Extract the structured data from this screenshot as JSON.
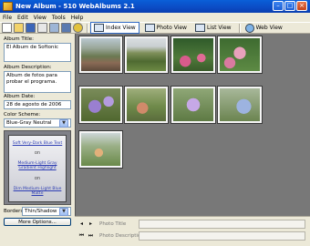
{
  "window": {
    "title": "New Album - 510 WebAlbums 2.1"
  },
  "menu": {
    "items": [
      "File",
      "Edit",
      "View",
      "Tools",
      "Help"
    ]
  },
  "toolbar": {
    "views": [
      {
        "label": "Index View",
        "active": true
      },
      {
        "label": "Photo View",
        "active": false
      },
      {
        "label": "List View",
        "active": false
      },
      {
        "label": "Web View",
        "active": false
      }
    ]
  },
  "left": {
    "album_title_label": "Album Title:",
    "album_title_value": "El Album de Softonic",
    "album_description_label": "Album Description:",
    "album_description_value": "Album de fotos para probar el programa.",
    "album_date_label": "Album Date:",
    "album_date_value": "28 de agosto de 2006",
    "color_scheme_label": "Color Scheme:",
    "color_scheme_value": "Blue-Gray Neutral",
    "scheme_preview": {
      "line1": "Soft Very-Dark Blue Text",
      "eq1": "on",
      "line2": "Medium-Light Gray Gradient Highlight",
      "eq2": "on",
      "line3": "Dim Medium-Light Blue Matte"
    },
    "borders_label": "Borders:",
    "borders_value": "Thin/Shadow",
    "more_options_label": "More Options..."
  },
  "bottom": {
    "photo_title_label": "Photo Title",
    "photo_description_label": "Photo Description"
  },
  "colors": {
    "titlebar": "#0b4bc4",
    "grid_bg": "#787878",
    "panel_bg": "#ece9d8"
  }
}
